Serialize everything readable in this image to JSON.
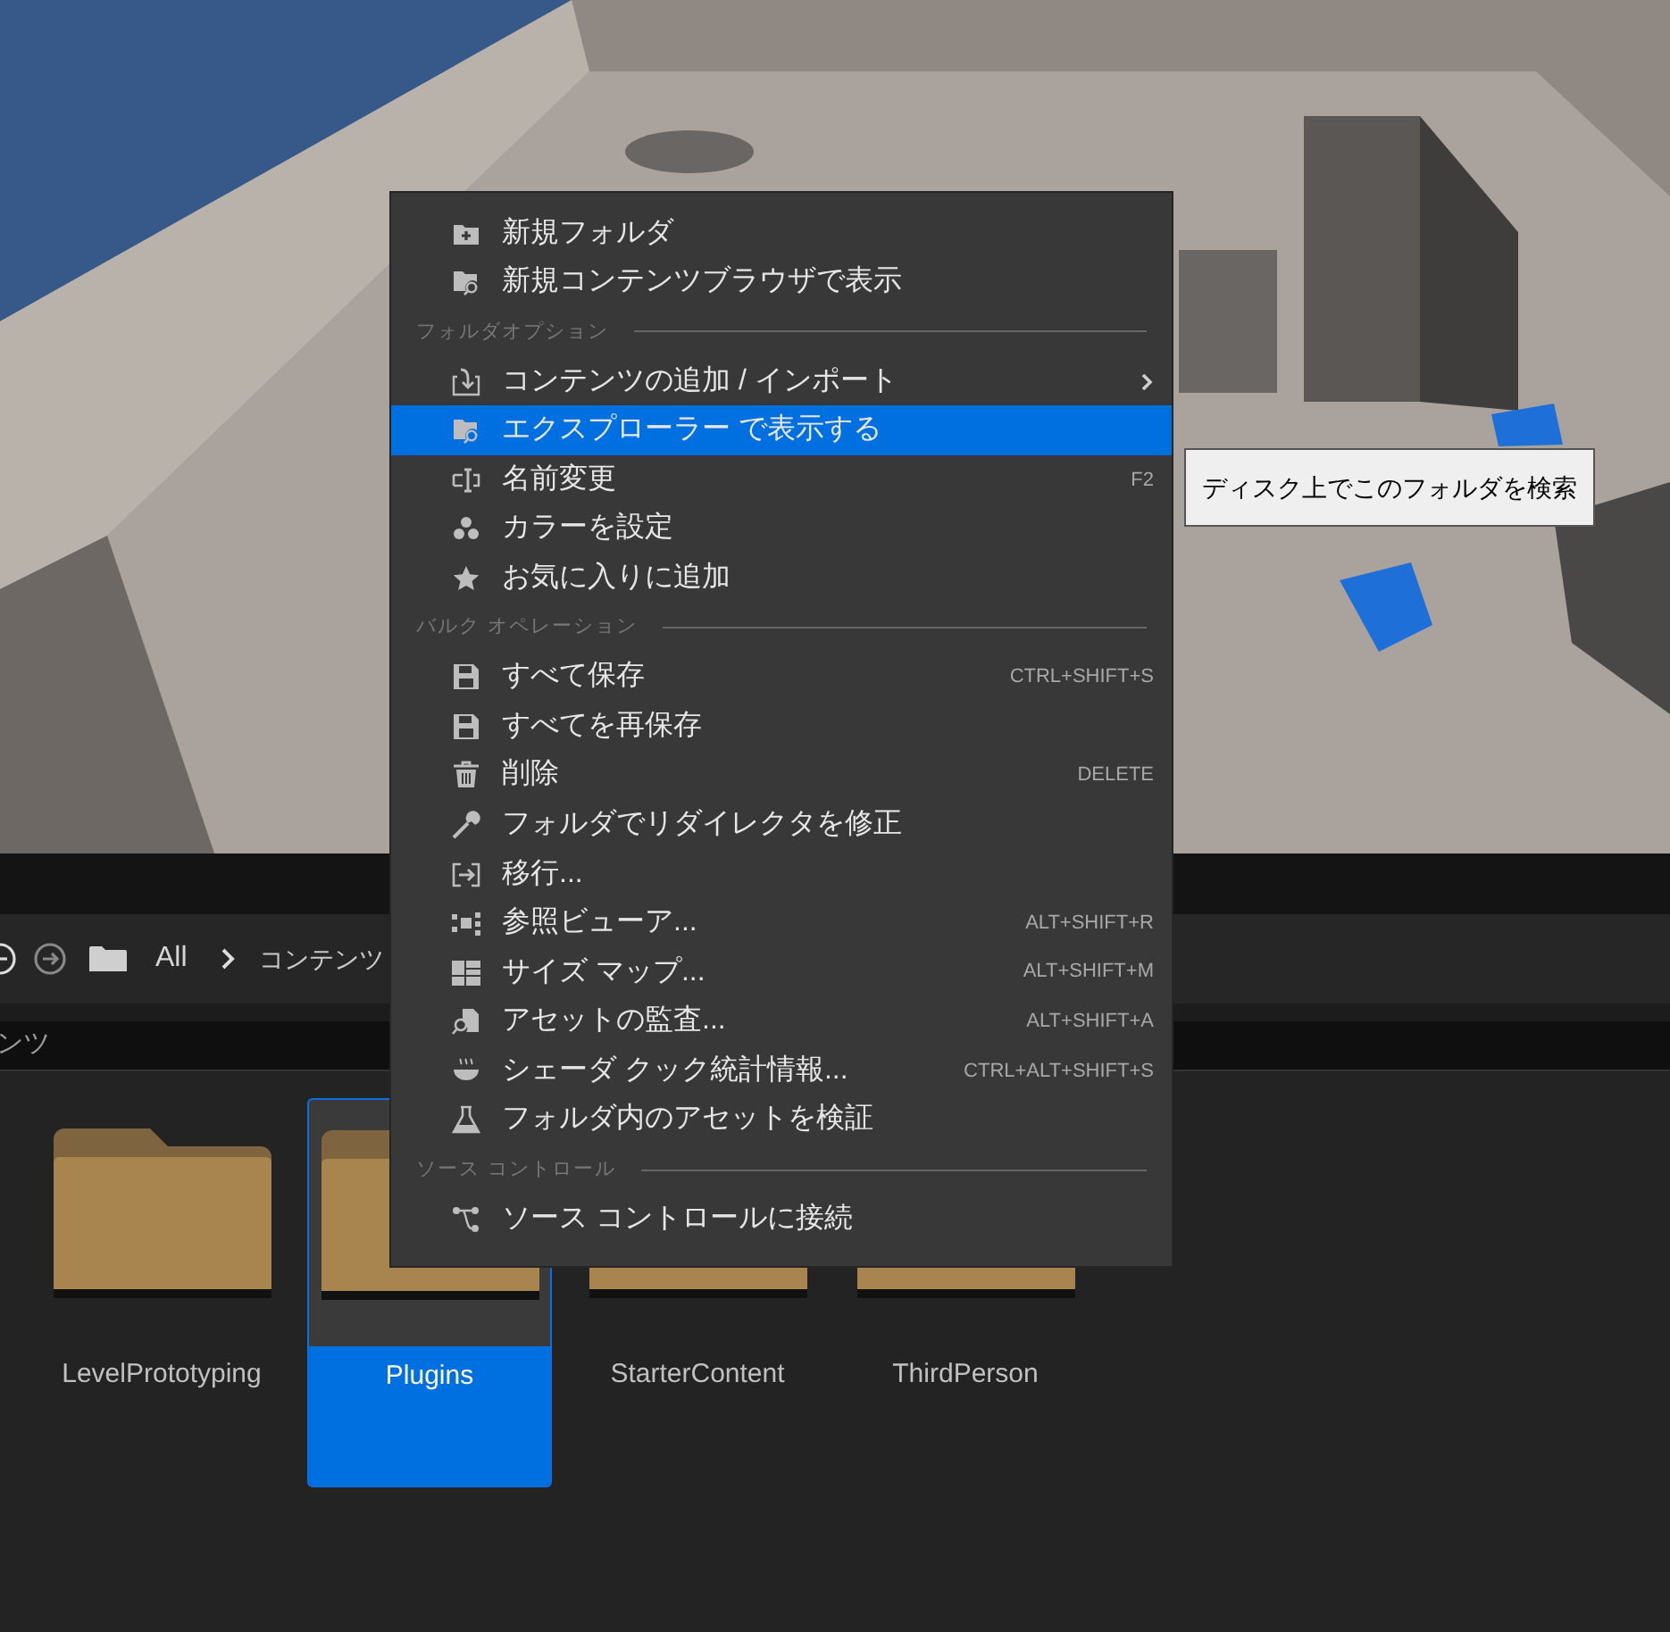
{
  "breadcrumb": {
    "root": "All",
    "path": "コンテンツ"
  },
  "search": {
    "value": "ンツ"
  },
  "folders": [
    {
      "name": "LevelPrototyping",
      "selected": false
    },
    {
      "name": "Plugins",
      "selected": true
    },
    {
      "name": "StarterContent",
      "selected": false
    },
    {
      "name": "ThirdPerson",
      "selected": false
    }
  ],
  "context_menu": [
    {
      "kind": "item",
      "label": "新規フォルダ",
      "selected": false
    },
    {
      "kind": "item",
      "label": "新規コンテンツブラウザで表示",
      "selected": false
    },
    {
      "kind": "header",
      "label": "フォルダオプション"
    },
    {
      "kind": "item",
      "label": "コンテンツの追加 / インポート",
      "selected": false,
      "has_submenu": true
    },
    {
      "kind": "item",
      "label": "エクスプローラー で表示する",
      "selected": true
    },
    {
      "kind": "item",
      "label": "名前変更",
      "shortcut": "F2",
      "selected": false
    },
    {
      "kind": "item",
      "label": "カラーを設定",
      "selected": false
    },
    {
      "kind": "item",
      "label": "お気に入りに追加",
      "selected": false
    },
    {
      "kind": "header",
      "label": "バルク オペレーション"
    },
    {
      "kind": "item",
      "label": "すべて保存",
      "shortcut": "CTRL+SHIFT+S",
      "selected": false
    },
    {
      "kind": "item",
      "label": "すべてを再保存",
      "selected": false
    },
    {
      "kind": "item",
      "label": "削除",
      "shortcut": "DELETE",
      "selected": false
    },
    {
      "kind": "item",
      "label": "フォルダでリダイレクタを修正",
      "selected": false
    },
    {
      "kind": "item",
      "label": "移行...",
      "selected": false
    },
    {
      "kind": "item",
      "label": "参照ビューア...",
      "shortcut": "ALT+SHIFT+R",
      "selected": false
    },
    {
      "kind": "item",
      "label": "サイズ マップ...",
      "shortcut": "ALT+SHIFT+M",
      "selected": false
    },
    {
      "kind": "item",
      "label": "アセットの監査...",
      "shortcut": "ALT+SHIFT+A",
      "selected": false
    },
    {
      "kind": "item",
      "label": "シェーダ クック統計情報...",
      "shortcut": "CTRL+ALT+SHIFT+S",
      "selected": false
    },
    {
      "kind": "item",
      "label": "フォルダ内のアセットを検証",
      "selected": false
    },
    {
      "kind": "header",
      "label": "ソース コントロール"
    },
    {
      "kind": "item",
      "label": "ソース コントロールに接続",
      "selected": false
    }
  ],
  "tooltip": "ディスク上でこのフォルダを検索"
}
